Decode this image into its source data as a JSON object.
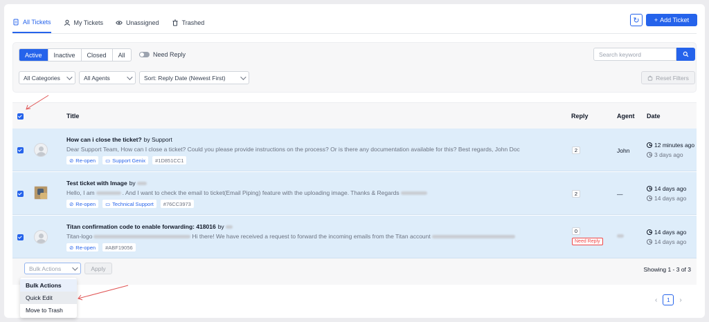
{
  "tabs": [
    {
      "label": "All Tickets",
      "icon": "file-icon"
    },
    {
      "label": "My Tickets",
      "icon": "user-icon"
    },
    {
      "label": "Unassigned",
      "icon": "eye-icon"
    },
    {
      "label": "Trashed",
      "icon": "trash-icon"
    }
  ],
  "header": {
    "add_ticket": "Add Ticket",
    "add_symbol": "+",
    "refresh_symbol": "↻"
  },
  "filters": {
    "status": [
      "Active",
      "Inactive",
      "Closed",
      "All"
    ],
    "need_reply_label": "Need Reply",
    "search_placeholder": "Search keyword",
    "category": "All Categories",
    "agents": "All Agents",
    "sort": "Sort: Reply Date (Newest First)",
    "reset": "Reset Filters"
  },
  "table": {
    "headers": {
      "title": "Title",
      "reply": "Reply",
      "agent": "Agent",
      "date": "Date"
    },
    "rows": [
      {
        "title": "How can i close the ticket?",
        "by": "by Support",
        "excerpt": "Dear Support Team, How can I close a ticket? Could you please provide instructions on the process? Or is there any documentation available for this? Best regards, John Doc",
        "chips": [
          "Re-open",
          "Support Genix",
          "#1D851CC1"
        ],
        "reply": "2",
        "agent": "John",
        "updated": "12 minutes ago",
        "created": "3 days ago"
      },
      {
        "title": "Test ticket with Image",
        "by": "by",
        "excerpt_a": "Hello, I am",
        "excerpt_b": ". And I want to check the email to ticket(Email Piping) feature with the uploading image. Thanks & Regards",
        "chips": [
          "Re-open",
          "Technical Support",
          "#76CC3973"
        ],
        "reply": "2",
        "agent": "—",
        "updated": "14 days ago",
        "created": "14 days ago"
      },
      {
        "title": "Titan confirmation code to enable forwarding: 418016",
        "by": "by",
        "excerpt_a": "Titan-logo",
        "excerpt_b": "Hi there! We have received a request to forward the incoming emails from the Titan account",
        "chips": [
          "Re-open",
          "#ABF19056"
        ],
        "reply": "0",
        "need_reply": "Need Reply",
        "updated": "14 days ago",
        "created": "14 days ago"
      }
    ]
  },
  "footer": {
    "bulk_placeholder": "Bulk Actions",
    "apply": "Apply",
    "showing": "Showing 1 - 3 of 3"
  },
  "bulk_menu": [
    "Bulk Actions",
    "Quick Edit",
    "Move to Trash"
  ],
  "pagination": {
    "current": "1",
    "prev": "‹",
    "next": "›"
  },
  "colors": {
    "primary": "#2563eb",
    "row_selected": "#deedfa",
    "annotation_arrow": "#e05252"
  }
}
